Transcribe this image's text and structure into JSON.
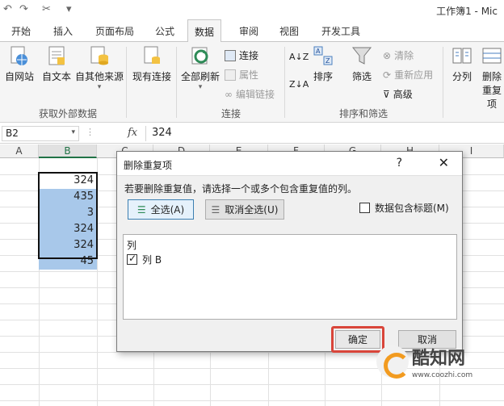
{
  "window": {
    "title": "工作簿1 - Mic"
  },
  "tabs": [
    "开始",
    "插入",
    "页面布局",
    "公式",
    "数据",
    "审阅",
    "视图",
    "开发工具"
  ],
  "ribbon": {
    "get_external": {
      "label": "获取外部数据",
      "items": [
        "自网站",
        "自文本",
        "自其他来源",
        "现有连接"
      ]
    },
    "connections": {
      "label": "连接",
      "refresh": "全部刷新",
      "items": [
        "连接",
        "属性",
        "编辑链接"
      ]
    },
    "sort_filter": {
      "label": "排序和筛选",
      "sort": "排序",
      "filter": "筛选",
      "items": [
        "清除",
        "重新应用",
        "高级"
      ]
    },
    "tools": {
      "split": "分列",
      "remove": "删除",
      "remove2": "重复项"
    }
  },
  "formula_bar": {
    "name_box": "B2",
    "fx": "fx",
    "value": "324"
  },
  "grid": {
    "columns": [
      "A",
      "B",
      "C",
      "D",
      "E",
      "F",
      "G",
      "H",
      "I"
    ],
    "cells_b": [
      "324",
      "435",
      "3",
      "324",
      "324",
      "45"
    ]
  },
  "dialog": {
    "title": "删除重复项",
    "help": "?",
    "close": "✕",
    "message": "若要删除重复值，请选择一个或多个包含重复值的列。",
    "select_all": "全选(A)",
    "unselect_all": "取消全选(U)",
    "has_header": "数据包含标题(M)",
    "list_header": "列",
    "list_item": "列 B",
    "ok": "确定",
    "cancel": "取消"
  },
  "watermark": {
    "name": "酷知网",
    "url": "www.coozhi.com"
  },
  "colors": {
    "accent": "#217346",
    "selection": "#a8c8ea",
    "highlight_ring": "#d9453a"
  }
}
